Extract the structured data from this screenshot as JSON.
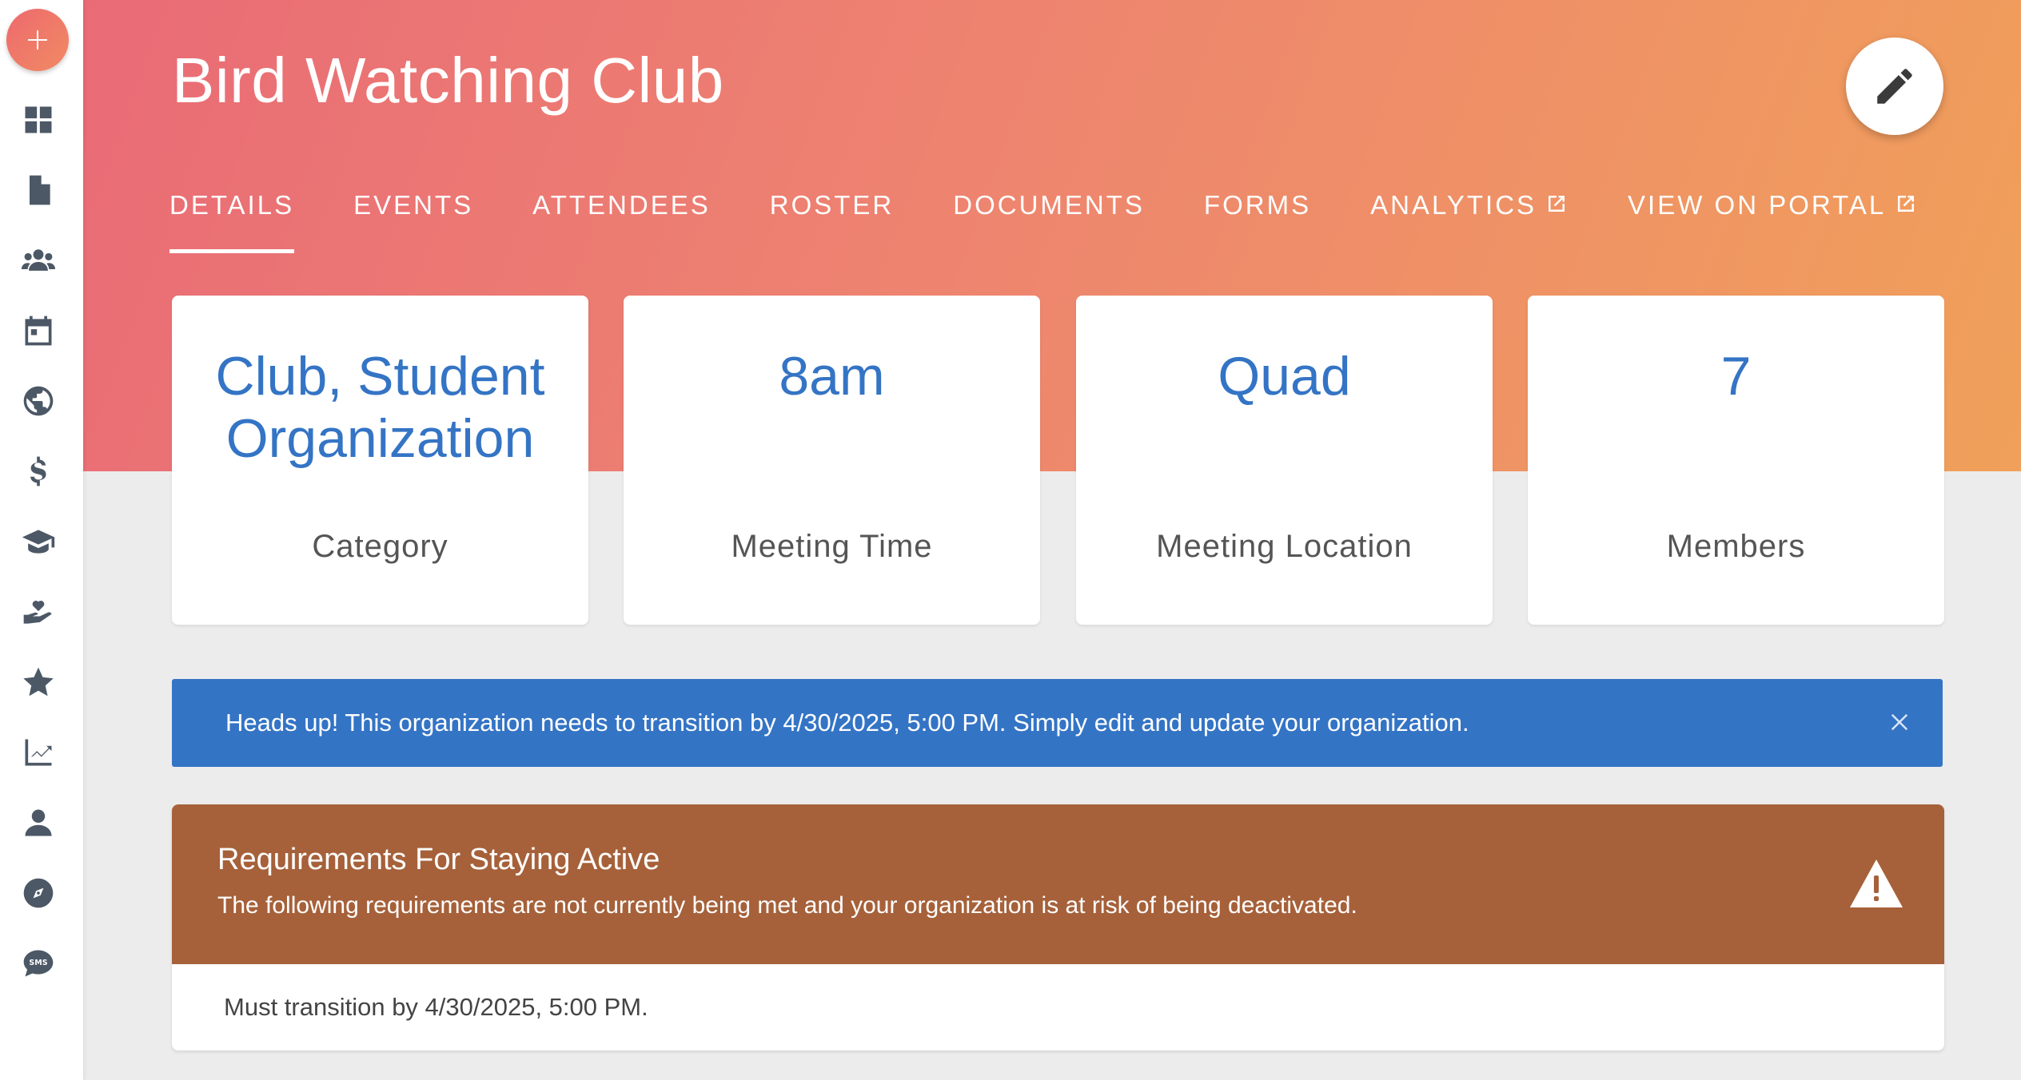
{
  "page": {
    "title": "Bird Watching Club"
  },
  "tabs": [
    {
      "label": "DETAILS",
      "active": true,
      "external": false
    },
    {
      "label": "EVENTS",
      "active": false,
      "external": false
    },
    {
      "label": "ATTENDEES",
      "active": false,
      "external": false
    },
    {
      "label": "ROSTER",
      "active": false,
      "external": false
    },
    {
      "label": "DOCUMENTS",
      "active": false,
      "external": false
    },
    {
      "label": "FORMS",
      "active": false,
      "external": false
    },
    {
      "label": "ANALYTICS",
      "active": false,
      "external": true
    },
    {
      "label": "VIEW ON PORTAL",
      "active": false,
      "external": true
    }
  ],
  "stats": [
    {
      "value": "Club, Student Organization",
      "label": "Category"
    },
    {
      "value": "8am",
      "label": "Meeting Time"
    },
    {
      "value": "Quad",
      "label": "Meeting Location"
    },
    {
      "value": "7",
      "label": "Members"
    }
  ],
  "banner": {
    "text": "Heads up! This organization needs to transition by 4/30/2025, 5:00 PM. Simply edit and update your organization."
  },
  "requirements": {
    "title": "Requirements For Staying Active",
    "description": "The following requirements are not currently being met and your organization is at risk of being deactivated.",
    "items": [
      "Must transition by 4/30/2025, 5:00 PM."
    ]
  },
  "sidebar": {
    "icons": [
      "dashboard-icon",
      "document-icon",
      "users-icon",
      "calendar-icon",
      "globe-icon",
      "dollar-icon",
      "graduation-cap-icon",
      "hand-heart-icon",
      "star-icon",
      "chart-icon",
      "person-icon",
      "compass-icon",
      "sms-icon"
    ]
  },
  "colors": {
    "accent": "#3474c5",
    "hero_start": "#e96b76",
    "hero_end": "#f0a05a",
    "warning": "#a6613a"
  }
}
